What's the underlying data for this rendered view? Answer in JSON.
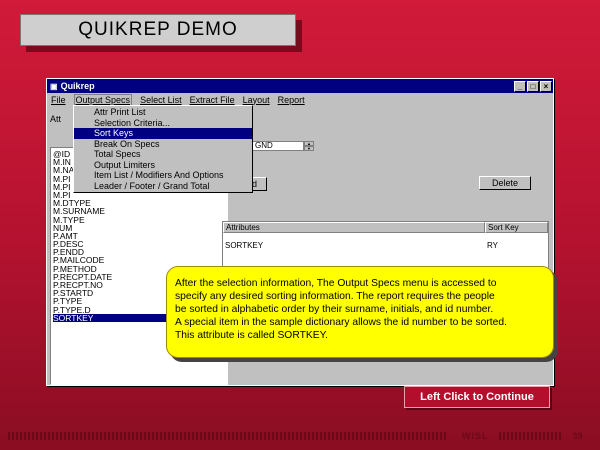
{
  "slide": {
    "title": "QUIKREP  DEMO",
    "continue_label": "Left Click to Continue",
    "footer_org": "WISL",
    "page_number": "39"
  },
  "window": {
    "title": "Quikrep",
    "menu": [
      "File",
      "Output Specs",
      "Select List",
      "Extract File",
      "Layout",
      "Report"
    ],
    "active_menu": "Output Specs",
    "dropdown_items": [
      "Attr Print List",
      "Selection Criteria...",
      "Sort Keys",
      "Break On Specs",
      "Total Specs",
      "Output Limiters",
      "Item List / Modifiers And Options",
      "Leader / Footer / Grand Total"
    ],
    "selected_dropdown_item": "Sort Keys",
    "side_label": "Att",
    "list_items": [
      "@ID",
      "M.IN",
      "M.NA",
      "M.PI",
      "M.PI",
      "M.PI",
      "M.DTYPE",
      "M.SURNAME",
      "M.TYPE",
      "NUM",
      "P.AMT",
      "P.DESC",
      "P.ENDD",
      "P.MAILCODE",
      "P.METHOD",
      "P.RECPT.DATE",
      "P.RECPT.NO",
      "P.STARTD",
      "P.TYPE",
      "P.TYPE.D",
      "SORTKEY"
    ],
    "selected_list_item": "SORTKEY",
    "combo_value": "GND",
    "add_label": "dd",
    "delete_label": "Delete",
    "table": {
      "headers": [
        "Attributes",
        "Sort Key"
      ],
      "rows": [
        [
          "SORTKEY",
          "RY"
        ]
      ]
    }
  },
  "callout": {
    "lines": [
      "After the selection information, The Output Specs menu is accessed to",
      "specify  any desired sorting information. The report requires the people",
      " be sorted in alphabetic order by their surname, initials, and id number.",
      " A special item in the sample dictionary allows the id number to be sorted.",
      "This attribute is called SORTKEY."
    ]
  }
}
